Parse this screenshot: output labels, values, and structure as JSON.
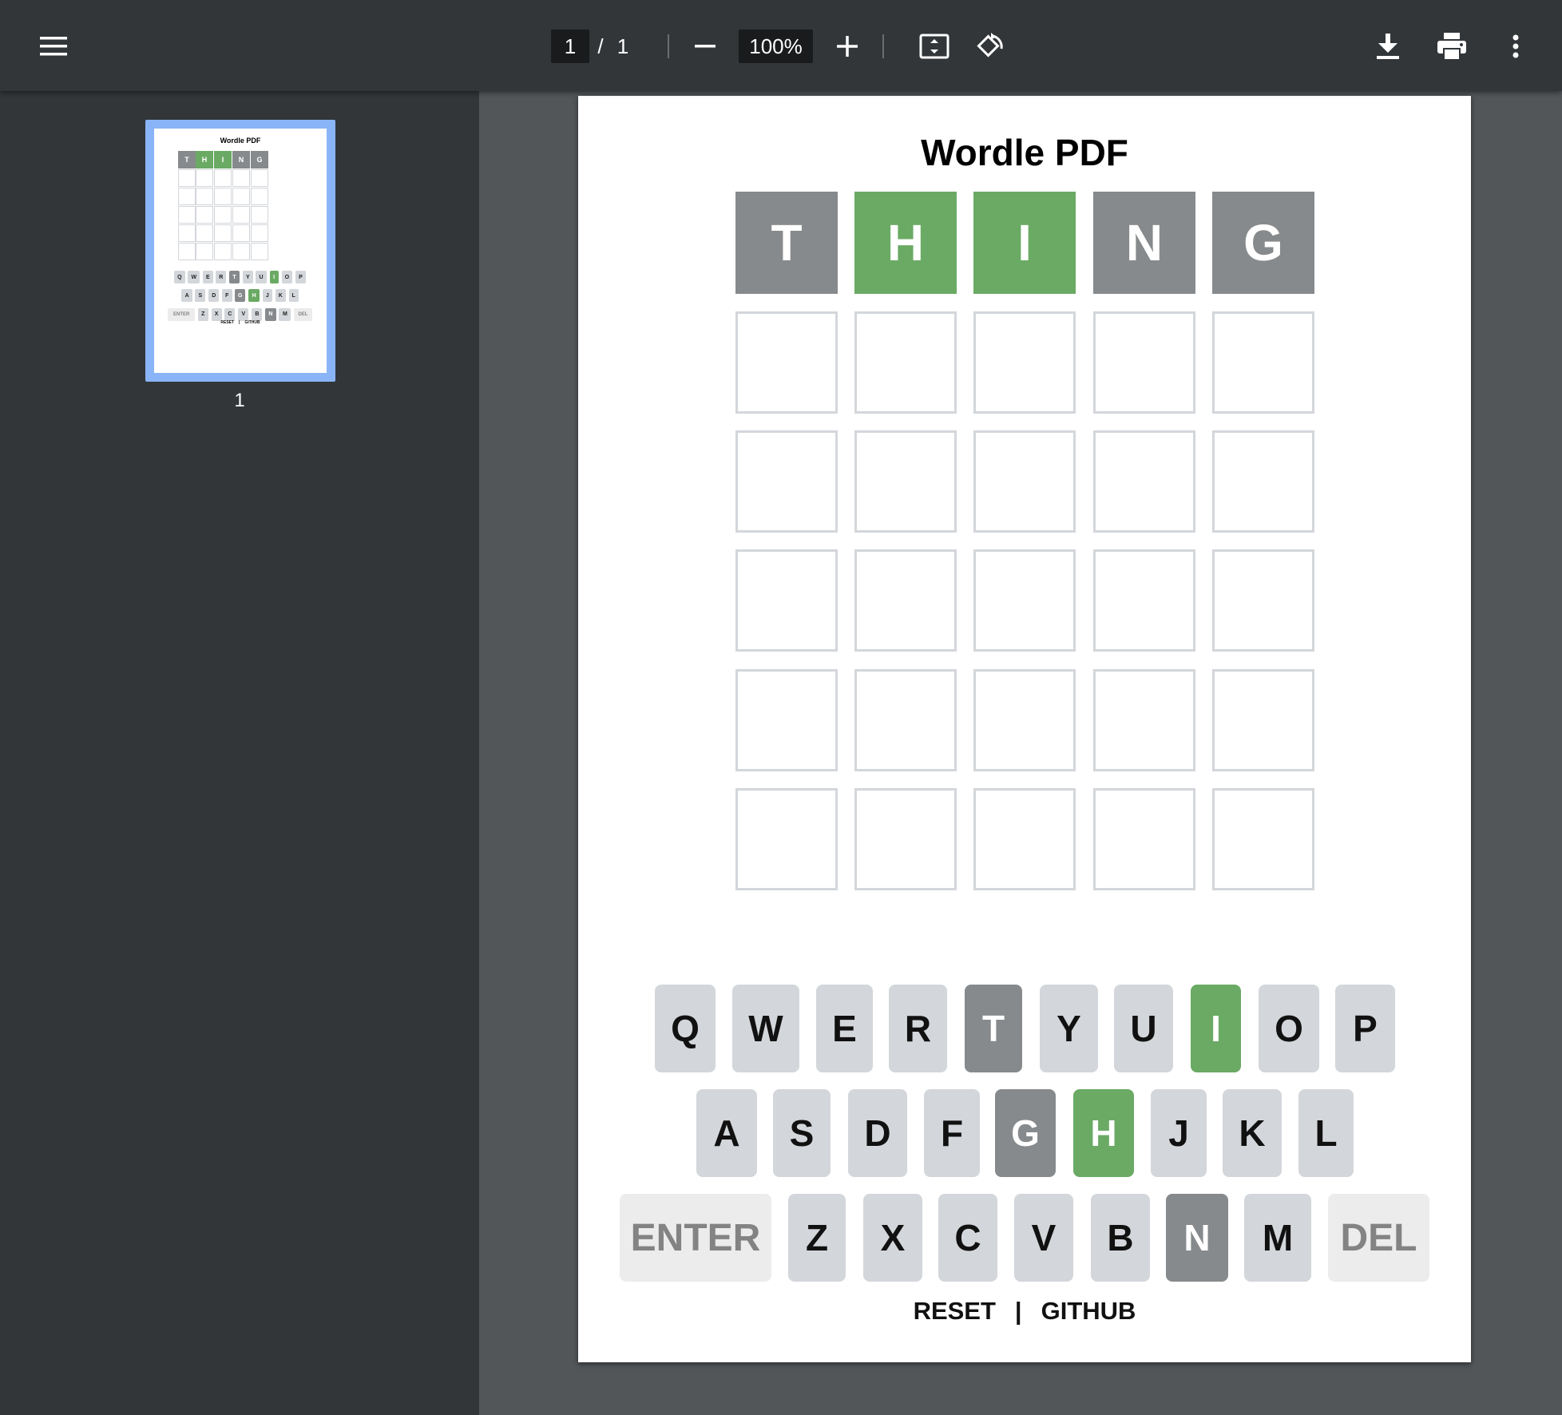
{
  "toolbar": {
    "current_page": "1",
    "separator": "/",
    "total_pages": "1",
    "zoom": "100%",
    "icons": [
      "menu-icon",
      "minus-icon",
      "plus-icon",
      "fit-page-icon",
      "rotate-icon",
      "download-icon",
      "print-icon",
      "more-vert-icon"
    ]
  },
  "sidebar": {
    "thumbnail_label": "1"
  },
  "document": {
    "title": "Wordle PDF",
    "colors": {
      "gray": "#878a8c",
      "green": "#6aaa64",
      "key": "#d3d6da",
      "empty_border": "#d3d6da"
    },
    "guess_rows": [
      [
        {
          "letter": "T",
          "state": "gray"
        },
        {
          "letter": "H",
          "state": "green"
        },
        {
          "letter": "I",
          "state": "green"
        },
        {
          "letter": "N",
          "state": "gray"
        },
        {
          "letter": "G",
          "state": "gray"
        }
      ],
      [
        {
          "letter": "",
          "state": "empty"
        },
        {
          "letter": "",
          "state": "empty"
        },
        {
          "letter": "",
          "state": "empty"
        },
        {
          "letter": "",
          "state": "empty"
        },
        {
          "letter": "",
          "state": "empty"
        }
      ],
      [
        {
          "letter": "",
          "state": "empty"
        },
        {
          "letter": "",
          "state": "empty"
        },
        {
          "letter": "",
          "state": "empty"
        },
        {
          "letter": "",
          "state": "empty"
        },
        {
          "letter": "",
          "state": "empty"
        }
      ],
      [
        {
          "letter": "",
          "state": "empty"
        },
        {
          "letter": "",
          "state": "empty"
        },
        {
          "letter": "",
          "state": "empty"
        },
        {
          "letter": "",
          "state": "empty"
        },
        {
          "letter": "",
          "state": "empty"
        }
      ],
      [
        {
          "letter": "",
          "state": "empty"
        },
        {
          "letter": "",
          "state": "empty"
        },
        {
          "letter": "",
          "state": "empty"
        },
        {
          "letter": "",
          "state": "empty"
        },
        {
          "letter": "",
          "state": "empty"
        }
      ],
      [
        {
          "letter": "",
          "state": "empty"
        },
        {
          "letter": "",
          "state": "empty"
        },
        {
          "letter": "",
          "state": "empty"
        },
        {
          "letter": "",
          "state": "empty"
        },
        {
          "letter": "",
          "state": "empty"
        }
      ]
    ],
    "keyboard": [
      [
        {
          "label": "Q",
          "state": "unused"
        },
        {
          "label": "W",
          "state": "unused"
        },
        {
          "label": "E",
          "state": "unused"
        },
        {
          "label": "R",
          "state": "unused"
        },
        {
          "label": "T",
          "state": "gray"
        },
        {
          "label": "Y",
          "state": "unused"
        },
        {
          "label": "U",
          "state": "unused"
        },
        {
          "label": "I",
          "state": "green"
        },
        {
          "label": "O",
          "state": "unused"
        },
        {
          "label": "P",
          "state": "unused"
        }
      ],
      [
        {
          "label": "A",
          "state": "unused"
        },
        {
          "label": "S",
          "state": "unused"
        },
        {
          "label": "D",
          "state": "unused"
        },
        {
          "label": "F",
          "state": "unused"
        },
        {
          "label": "G",
          "state": "gray"
        },
        {
          "label": "H",
          "state": "green"
        },
        {
          "label": "J",
          "state": "unused"
        },
        {
          "label": "K",
          "state": "unused"
        },
        {
          "label": "L",
          "state": "unused"
        }
      ],
      [
        {
          "label": "ENTER",
          "state": "wide"
        },
        {
          "label": "Z",
          "state": "unused"
        },
        {
          "label": "X",
          "state": "unused"
        },
        {
          "label": "C",
          "state": "unused"
        },
        {
          "label": "V",
          "state": "unused"
        },
        {
          "label": "B",
          "state": "unused"
        },
        {
          "label": "N",
          "state": "gray"
        },
        {
          "label": "M",
          "state": "unused"
        },
        {
          "label": "DEL",
          "state": "wide"
        }
      ]
    ],
    "links": {
      "reset": "RESET",
      "separator": "|",
      "github": "GITHUB"
    }
  }
}
